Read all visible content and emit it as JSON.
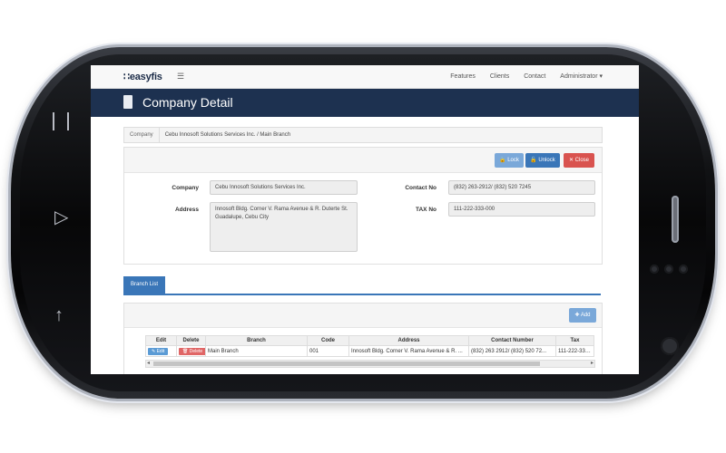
{
  "app": {
    "logo": "easyfis",
    "menu_icon": "hamburger-icon",
    "nav": [
      "Features",
      "Clients",
      "Contact",
      "Administrator ▾"
    ]
  },
  "banner": {
    "title": "Company Detail",
    "icon": "document-icon"
  },
  "breadcrumb": {
    "label": "Company",
    "value": "Cebu Innosoft Solutions Services Inc. / Main Branch"
  },
  "actions": {
    "lock": "Lock",
    "unlock": "Unlock",
    "close": "Close"
  },
  "form": {
    "company_label": "Company",
    "company_value": "Cebu Innosoft Solutions Services Inc.",
    "address_label": "Address",
    "address_value": "Innosoft Bldg. Corner V. Rama Avenue & R. Duterte St. Guadalupe, Cebu City",
    "contact_label": "Contact No",
    "contact_value": "(832) 263-2912/ (832) 520 7245",
    "tax_label": "TAX No",
    "tax_value": "111-222-333-000"
  },
  "branch_tab": {
    "label": "Branch List"
  },
  "branch_list": {
    "add": "Add",
    "columns": [
      "Edit",
      "Delete",
      "Branch",
      "Code",
      "Address",
      "Contact Number",
      "Tax"
    ],
    "rows": [
      {
        "edit": "Edit",
        "delete": "Delete",
        "branch": "Main Branch",
        "code": "001",
        "address": "Innosoft Bldg. Corner V. Rama Avenue & R. ...",
        "contact": "(832) 263 2912/ (832) 520 72...",
        "tax": "111-222-333..."
      }
    ]
  },
  "device": {
    "buttons": [
      "menu-icon",
      "back-icon",
      "home-icon"
    ]
  }
}
